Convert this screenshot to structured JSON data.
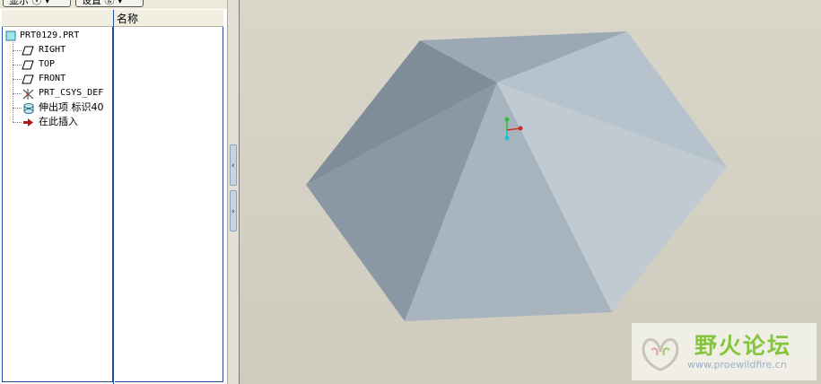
{
  "toolbar": {
    "show_button": "显示 ⓥ ▾",
    "settings_button": "设置 ⓖ ▾"
  },
  "tree": {
    "name_column_header": "名称",
    "items": [
      {
        "label": "PRT0129.PRT",
        "icon": "part-icon"
      },
      {
        "label": "RIGHT",
        "icon": "datum-plane-icon"
      },
      {
        "label": "TOP",
        "icon": "datum-plane-icon"
      },
      {
        "label": "FRONT",
        "icon": "datum-plane-icon"
      },
      {
        "label": "PRT_CSYS_DEF",
        "icon": "coordinate-system-icon"
      },
      {
        "label": "伸出项 标识40",
        "icon": "protrusion-feature-icon"
      },
      {
        "label": "在此插入",
        "icon": "insert-here-arrow-icon"
      }
    ]
  },
  "splitter": {
    "collapse_arrow": "‹",
    "expand_arrow": "›"
  },
  "model": {
    "face_colors": [
      "#7f8d98",
      "#9ca9b4",
      "#8a98a3",
      "#b6c2cc",
      "#bfcad3",
      "#a8b5bf",
      "#96a3ae"
    ]
  },
  "watermark": {
    "title": "野火论坛",
    "url": "www.proewildfire.cn"
  }
}
